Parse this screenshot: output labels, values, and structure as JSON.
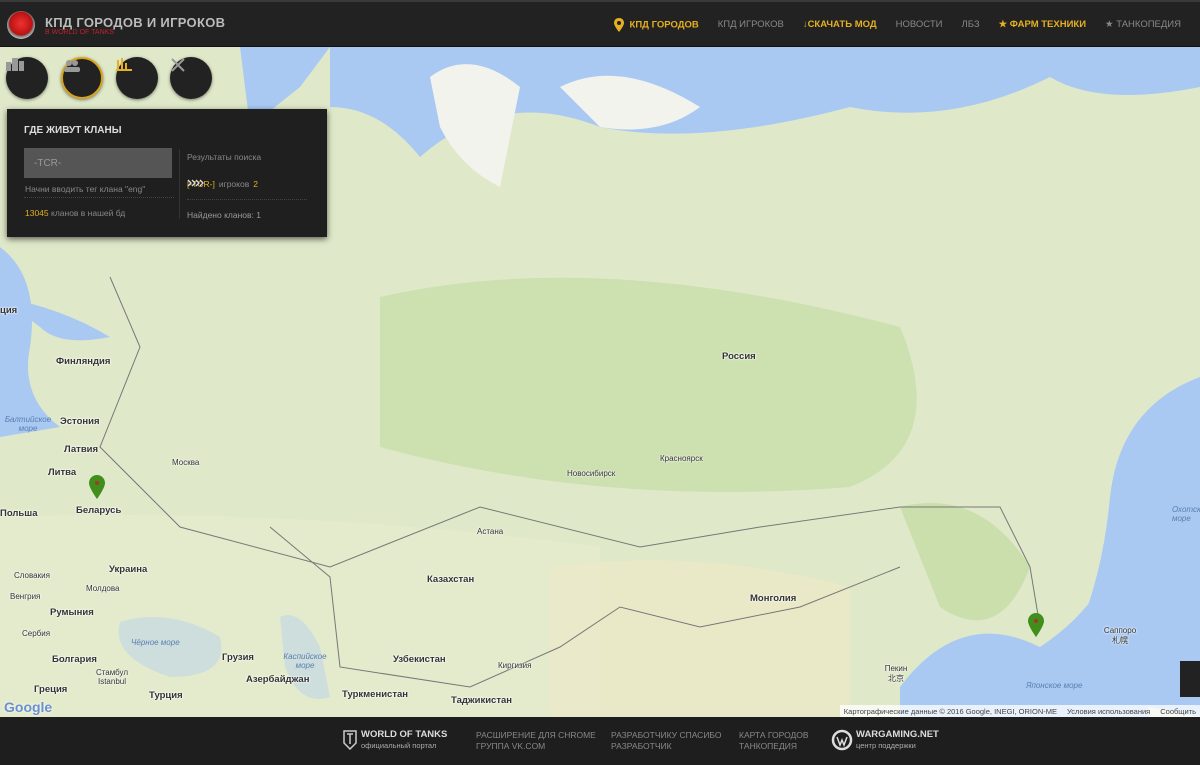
{
  "header": {
    "title": "КПД ГОРОДОВ И ИГРОКОВ",
    "subtitle": "В WORLD OF TANKS",
    "nav": [
      "КПД ГОРОДОВ",
      "КПД ИГРОКОВ",
      "↓СКАЧАТЬ МОД",
      "НОВОСТИ",
      "ЛБЗ",
      "★ ФАРМ ТЕХНИКИ",
      "★ ТАНКОПЕДИЯ"
    ]
  },
  "toolbar": {
    "buttons": [
      "cities-icon",
      "players-icon",
      "stats-icon",
      "battles-icon"
    ],
    "active": 1
  },
  "panel": {
    "title": "ГДЕ ЖИВУТ КЛАНЫ",
    "input_value": "-TCR-",
    "hint": "Начни вводить тег клана \"eng\"",
    "count_value": "13045",
    "count_label": " кланов в нашей бд",
    "results_title": "Результаты поиска",
    "result_tag": "[-TCR-]",
    "result_label": " игроков ",
    "result_count": "2",
    "found": "Найдено кланов: 1"
  },
  "map": {
    "labels": [
      "Россия",
      "Финляндия",
      "Эстония",
      "Латвия",
      "Литва",
      "Беларусь",
      "Польша",
      "Украина",
      "Молдова",
      "Словакия",
      "Венгрия",
      "Румыния",
      "Сербия",
      "Болгария",
      "Греция",
      "Турция",
      "Грузия",
      "Азербайджан",
      "Казахстан",
      "Узбекистан",
      "Туркменистан",
      "Киргизия",
      "Таджикистан",
      "Монголия",
      "Москва",
      "Новосибирск",
      "Красноярск",
      "Астана",
      "Пекин 北京",
      "Саппоро 札幌",
      "Стамбул Istanbul",
      "ция"
    ],
    "seas": [
      "Балтийское море",
      "Чёрное море",
      "Каспийское море",
      "Японское море",
      "Охотское море"
    ],
    "attribution": "Картографические данные © 2016 Google, INEGI, ORION-ME",
    "terms": "Условия использования",
    "report": "Сообщить",
    "google": "Google"
  },
  "footer": {
    "wot": "WORLD OF TANKS",
    "wot_sub": "официальный портал",
    "col1": [
      "РАСШИРЕНИЕ ДЛЯ CHROME",
      "ГРУППА VK.COM"
    ],
    "col2": [
      "РАЗРАБОТЧИКУ СПАСИБО",
      "РАЗРАБОТЧИК"
    ],
    "col3": [
      "КАРТА ГОРОДОВ",
      "ТАНКОПЕДИЯ"
    ],
    "wg": "WARGAMING.NET",
    "wg_sub": "центр поддержки"
  },
  "colors": {
    "accent": "#e5b021",
    "land": "#dfe9c9",
    "water": "#a9c9f3",
    "forest": "#c4dca4",
    "marker": "#3f8f1a"
  }
}
